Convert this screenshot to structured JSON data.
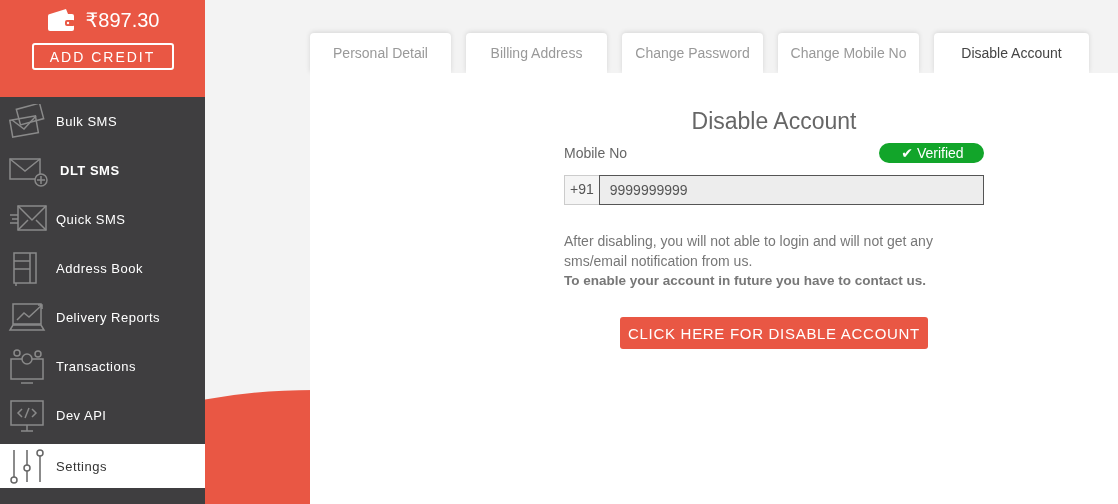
{
  "wallet": {
    "balance": "₹897.30",
    "button": "ADD CREDIT"
  },
  "sidebar": {
    "items": [
      {
        "label": "Bulk SMS",
        "selected": false,
        "highlighted": false
      },
      {
        "label": "DLT SMS",
        "selected": false,
        "highlighted": true
      },
      {
        "label": "Quick SMS",
        "selected": false,
        "highlighted": false
      },
      {
        "label": "Address Book",
        "selected": false,
        "highlighted": false
      },
      {
        "label": "Delivery Reports",
        "selected": false,
        "highlighted": false
      },
      {
        "label": "Transactions",
        "selected": false,
        "highlighted": false
      },
      {
        "label": "Dev API",
        "selected": false,
        "highlighted": false
      },
      {
        "label": "Settings",
        "selected": true,
        "highlighted": false
      }
    ]
  },
  "tabs": [
    {
      "label": "Personal Detail",
      "selected": false
    },
    {
      "label": "Billing Address",
      "selected": false
    },
    {
      "label": "Change Password",
      "selected": false
    },
    {
      "label": "Change Mobile No",
      "selected": false
    },
    {
      "label": "Disable Account",
      "selected": true
    }
  ],
  "form": {
    "title": "Disable Account",
    "field_label": "Mobile No",
    "verified": true,
    "badge": "✔ Verified",
    "prefix": "+91",
    "value": "9999999999",
    "notice": "After disabling, you will not able to login and will not get any sms/email notification from us.",
    "notice_strong": "To enable your account in future you have to contact us.",
    "button": "CLICK HERE FOR DISABLE ACCOUNT"
  }
}
